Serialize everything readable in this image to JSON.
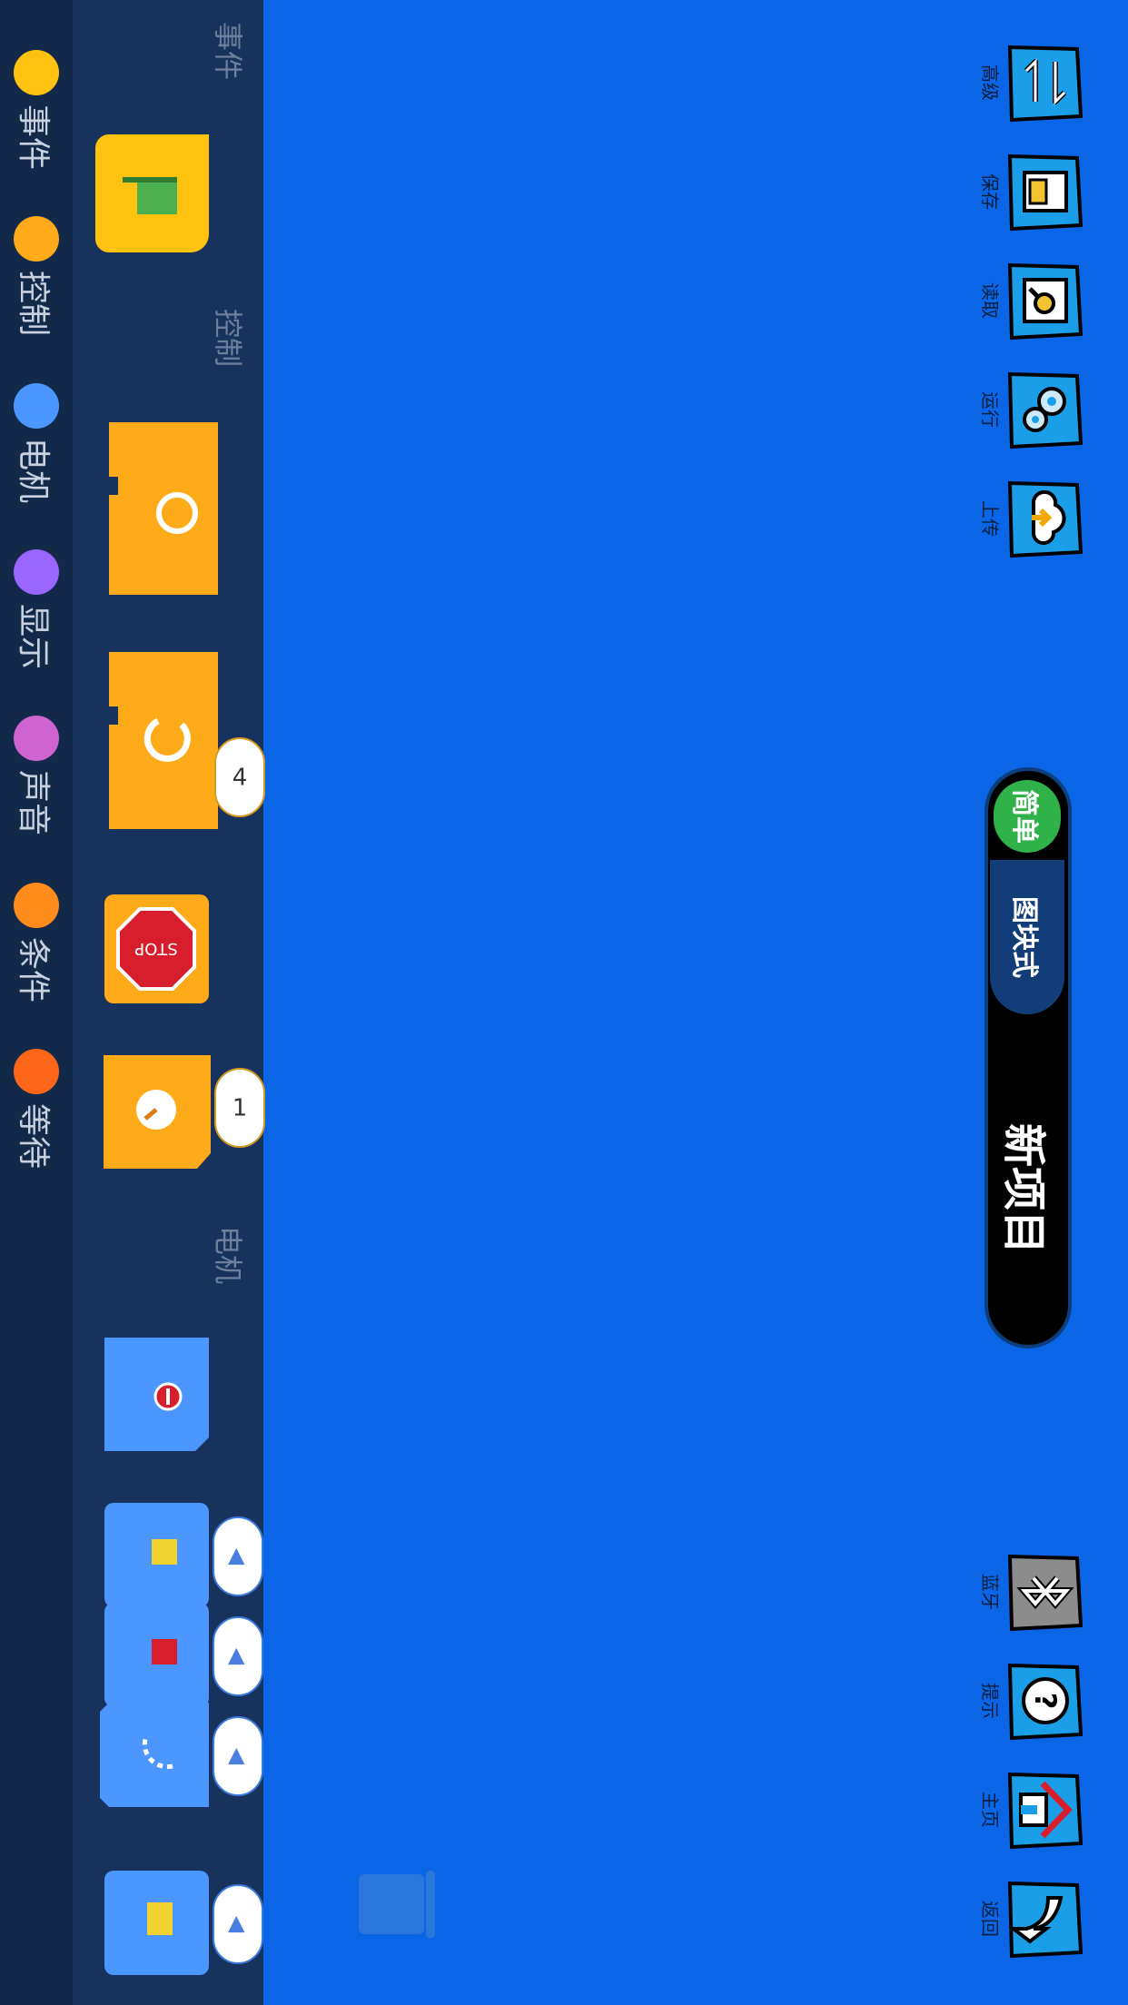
{
  "toolbar_left": [
    {
      "id": "advanced",
      "label": "高级",
      "icon": "swap-arrows-icon"
    },
    {
      "id": "save",
      "label": "保存",
      "icon": "save-icon"
    },
    {
      "id": "load",
      "label": "读取",
      "icon": "load-search-icon"
    },
    {
      "id": "run",
      "label": "运行",
      "icon": "gears-icon"
    },
    {
      "id": "upload",
      "label": "上传",
      "icon": "cloud-upload-icon"
    }
  ],
  "toolbar_right": [
    {
      "id": "bluetooth",
      "label": "蓝牙",
      "icon": "bluetooth-icon"
    },
    {
      "id": "hint",
      "label": "提示",
      "icon": "question-icon"
    },
    {
      "id": "home",
      "label": "主页",
      "icon": "home-icon"
    },
    {
      "id": "back",
      "label": "返回",
      "icon": "back-arrow-icon"
    }
  ],
  "mode": {
    "simple": "简单",
    "graphical": "图块式",
    "project": "新项目"
  },
  "palette": {
    "sections": {
      "events": "事件",
      "control": "控制",
      "motor": "电机"
    },
    "repeat_count": "4",
    "wait_value": "1"
  },
  "categories": [
    {
      "label": "事件",
      "color": "#ffc20e"
    },
    {
      "label": "控制",
      "color": "#ffab19"
    },
    {
      "label": "电机",
      "color": "#4c97ff"
    },
    {
      "label": "显示",
      "color": "#9966ff"
    },
    {
      "label": "声音",
      "color": "#cf63cf"
    },
    {
      "label": "条件",
      "color": "#ff8c1a"
    },
    {
      "label": "等待",
      "color": "#ff661a"
    }
  ],
  "colors": {
    "workspace": "#0a66e6",
    "palette": "#17325c",
    "category_bar": "#13294a"
  }
}
